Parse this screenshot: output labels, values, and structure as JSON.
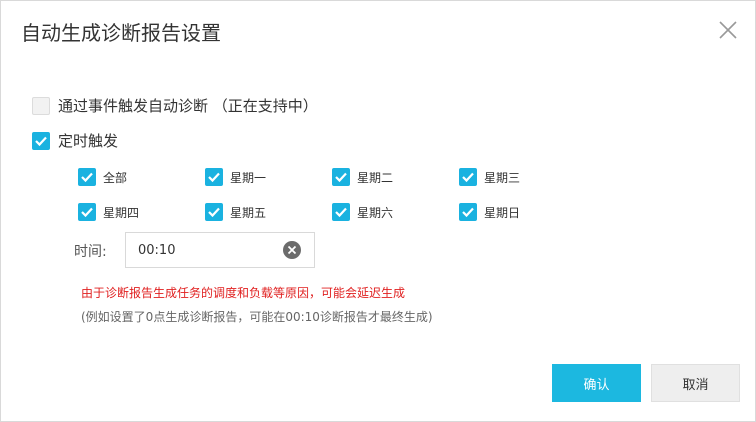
{
  "dialog": {
    "title": "自动生成诊断报告设置",
    "close_icon": "close-icon"
  },
  "options": {
    "event_trigger": {
      "label": "通过事件触发自动诊断 （正在支持中）",
      "checked": false
    },
    "timed_trigger": {
      "label": "定时触发",
      "checked": true
    }
  },
  "days": [
    {
      "label": "全部",
      "checked": true
    },
    {
      "label": "星期一",
      "checked": true
    },
    {
      "label": "星期二",
      "checked": true
    },
    {
      "label": "星期三",
      "checked": true
    },
    {
      "label": "星期四",
      "checked": true
    },
    {
      "label": "星期五",
      "checked": true
    },
    {
      "label": "星期六",
      "checked": true
    },
    {
      "label": "星期日",
      "checked": true
    }
  ],
  "time": {
    "label": "时间:",
    "value": "00:10",
    "clear_icon": "clear-icon"
  },
  "notes": {
    "warning": "由于诊断报告生成任务的调度和负载等原因，可能会延迟生成",
    "example": "(例如设置了0点生成诊断报告，可能在00:10诊断报告才最终生成)"
  },
  "buttons": {
    "confirm": "确认",
    "cancel": "取消"
  },
  "colors": {
    "accent": "#1cb8e0",
    "checkbox": "#1ab2e0",
    "warning_text": "#e02020"
  }
}
